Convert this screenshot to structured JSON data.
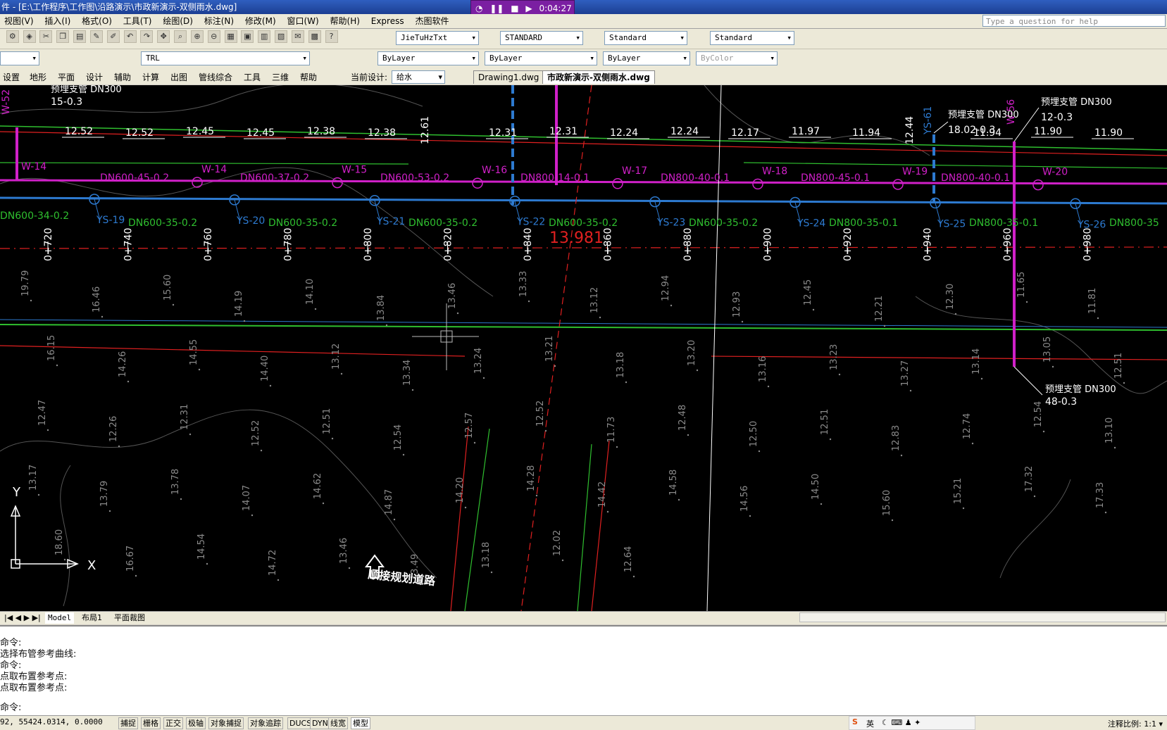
{
  "window": {
    "title": "件 - [E:\\工作程序\\工作图\\沿路演示\\市政新演示-双侧雨水.dwg]"
  },
  "recorder": {
    "time": "0:04:27"
  },
  "menu": [
    "视图(V)",
    "插入(I)",
    "格式(O)",
    "工具(T)",
    "绘图(D)",
    "标注(N)",
    "修改(M)",
    "窗口(W)",
    "帮助(H)",
    "Express",
    "杰图软件"
  ],
  "help": {
    "placeholder": "Type a question for help"
  },
  "toolbar1": {
    "text_style": "JieTuHzTxt",
    "dim_style": "STANDARD",
    "table_style": "Standard",
    "mleader_style": "Standard"
  },
  "toolbar2": {
    "layer": "TRL",
    "color": "ByLayer",
    "linetype": "ByLayer",
    "lineweight": "ByLayer",
    "plotstyle": "ByColor"
  },
  "appmenu": [
    "设置",
    "地形",
    "平面",
    "设计",
    "辅助",
    "计算",
    "出图",
    "管线综合",
    "工具",
    "三维",
    "帮助"
  ],
  "current_design": {
    "label": "当前设计:",
    "value": "给水"
  },
  "doc_tabs": [
    "Drawing1.dwg",
    "市政新演示-双侧雨水.dwg"
  ],
  "drawing": {
    "stations": [
      "0+720",
      "0+740",
      "0+760",
      "0+780",
      "0+800",
      "0+820",
      "0+840",
      "0+860",
      "0+880",
      "0+900",
      "0+920",
      "0+940",
      "0+960",
      "0+980"
    ],
    "manholes_ys": [
      "YS-19",
      "YS-20",
      "YS-21",
      "YS-22",
      "YS-23",
      "YS-24",
      "YS-25",
      "YS-26"
    ],
    "manholes_w": [
      "W-14",
      "W-15",
      "W-16",
      "W-17",
      "W-18",
      "W-19",
      "W-20"
    ],
    "top_labels": [
      "W-52",
      "W-56",
      "YS-61",
      "W-14"
    ],
    "elev_top": [
      "12.52",
      "12.52",
      "12.45",
      "12.45",
      "12.38",
      "12.38",
      "12.61",
      "12.31",
      "12.31",
      "12.24",
      "12.24",
      "12.17",
      "11.97",
      "11.94",
      "12.44",
      "11.94",
      "11.90",
      "11.90"
    ],
    "pipe_blue": [
      "DN600-35-0.2",
      "DN600-35-0.2",
      "DN600-35-0.2",
      "DN600-35-0.2",
      "DN600-35-0.2",
      "DN800-35-0.1",
      "DN800-35-0.1",
      "DN800-35",
      "DN600-34-0.2"
    ],
    "pipe_mag": [
      "DN600-45-0.2",
      "DN600-37-0.2",
      "DN600-53-0.2",
      "DN800-14-0.1",
      "DN800-40-0.1",
      "DN800-45-0.1",
      "DN800-40-0.1"
    ],
    "stubs": [
      {
        "title": "预埋支管 DN300",
        "value": "15-0.3"
      },
      {
        "title": "预埋支管 DN300",
        "value": "18.02-0.3"
      },
      {
        "title": "预埋支管 DN300",
        "value": "12-0.3"
      },
      {
        "title": "预埋支管 DN300",
        "value": "48-0.3"
      }
    ],
    "center_value": "13.981",
    "arrow_label": "顺接规划道路",
    "ucs": {
      "y": "Y",
      "x": "X"
    },
    "spot_elevs": [
      "19.79",
      "16.46",
      "15.60",
      "14.19",
      "14.10",
      "13.84",
      "13.46",
      "13.33",
      "13.12",
      "12.94",
      "12.93",
      "12.45",
      "12.21",
      "12.30",
      "11.65",
      "11.81",
      "16.15",
      "14.26",
      "14.55",
      "14.40",
      "13.12",
      "13.34",
      "13.24",
      "13.21",
      "13.18",
      "13.20",
      "13.16",
      "13.23",
      "13.27",
      "13.14",
      "13.05",
      "12.51",
      "12.47",
      "12.26",
      "12.31",
      "12.52",
      "12.51",
      "12.54",
      "12.57",
      "12.52",
      "11.73",
      "12.48",
      "12.50",
      "12.51",
      "12.83",
      "12.74",
      "12.54",
      "13.10",
      "13.17",
      "13.79",
      "13.78",
      "14.07",
      "14.62",
      "14.87",
      "14.20",
      "14.28",
      "14.42",
      "14.58",
      "14.56",
      "14.50",
      "15.60",
      "15.21",
      "17.32",
      "17.33",
      "18.60",
      "16.67",
      "14.54",
      "14.72",
      "13.46",
      "13.49",
      "13.18",
      "12.02",
      "12.64"
    ]
  },
  "layout_tabs": [
    "Model",
    "布局1",
    "平面裁图"
  ],
  "command_lines": [
    "命令:",
    "选择布管参考曲线:",
    "命令:",
    "点取布置参考点:",
    "点取布置参考点:",
    "",
    "命令:"
  ],
  "status": {
    "coords": "92, 55424.0314, 0.0000",
    "toggles": [
      "捕捉",
      "栅格",
      "正交",
      "极轴",
      "对象捕捉",
      "对象追踪",
      "DUCS",
      "DYN",
      "线宽",
      "模型"
    ],
    "ime_label": "英",
    "annotation_scale_label": "注释比例:",
    "annotation_scale_value": "1:1"
  },
  "colors": {
    "magenta": "#d020c8",
    "blue": "#2d7ad0",
    "green": "#2fbf2f",
    "red": "#e02020",
    "gray": "#8a8a8a",
    "white": "#ffffff"
  }
}
